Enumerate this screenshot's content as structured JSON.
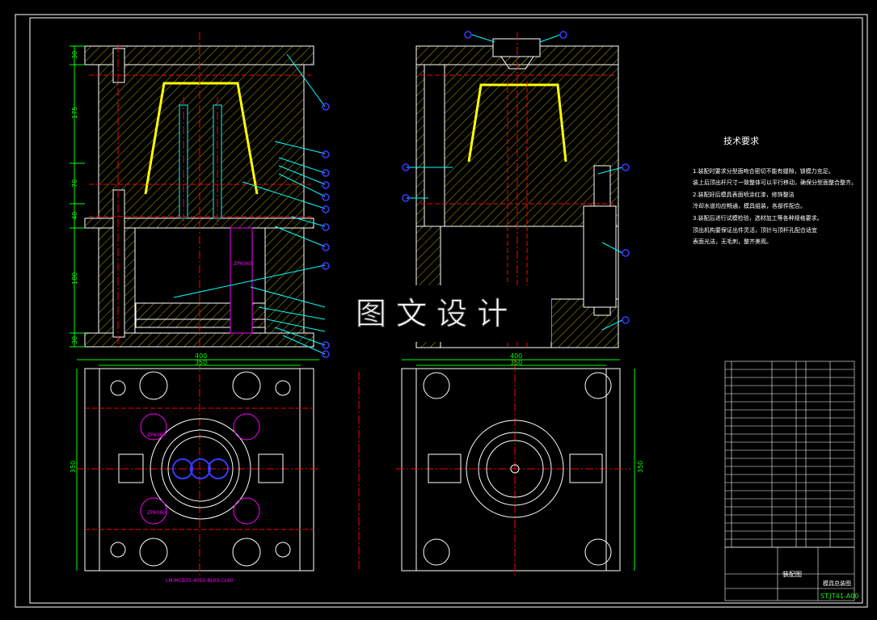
{
  "watermark": "图 文 设 计",
  "tech_requirements": {
    "title": "技术要求",
    "lines": [
      "1.装配时要求分型面吻合密切不能有缝隙，锁模力充足。",
      "装上后顶出杆尺寸一致整体可以平行移动，确保分型面整合整齐。",
      "2.装配好后模具表面喷涂红漆，修饰整洁",
      "冷却水道均应畅通，模具组装，各部件配合。",
      "3.装配后进行试模检验，选材加工等各种规格要求。",
      "顶出机构要保证出件灵活，顶针与顶杆孔配合适宜",
      "表面光洁，无毛刺，整齐美观。"
    ]
  },
  "dimensions": {
    "left_vertical": [
      "30",
      "175",
      "70",
      "40",
      "180",
      "30"
    ],
    "bottom_left_width": "400",
    "bottom_left_inner": "350",
    "bottom_right_width": "400",
    "bottom_right_inner": "350",
    "left_height": "350",
    "right_height": "350"
  },
  "labels": {
    "cylinder_1": "ZP6060",
    "cylinder_2": "ZP6060",
    "cylinder_3": "ZP6060",
    "mold_base_spec": "LM-MCB35-4050-BL60-CL60"
  },
  "title_block": {
    "drawing_name": "装配图",
    "drawing_number": "ST.JT41-A00",
    "note": "模具总装图"
  },
  "colors": {
    "background": "#000000",
    "outline": "#ffffff",
    "hatch": "#ffff00",
    "centerline": "#ff0000",
    "dimension": "#00ff00",
    "leader": "#00ffff",
    "balloon": "#3a3aff",
    "cylinder": "#ff00ff"
  }
}
